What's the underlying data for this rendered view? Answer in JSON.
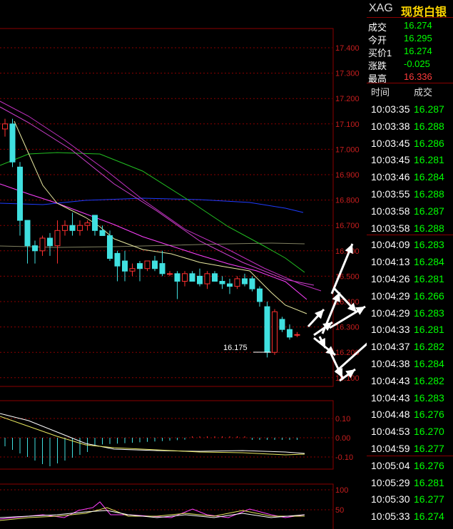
{
  "instrument": {
    "code": "XAG",
    "name": "现货白银"
  },
  "quote": [
    {
      "label": "成交",
      "value": "16.274",
      "color": "#00ff00"
    },
    {
      "label": "今开",
      "value": "16.295",
      "color": "#00ff00"
    },
    {
      "label": "买价1",
      "value": "16.274",
      "color": "#00ff00"
    },
    {
      "label": "涨跌",
      "value": "-0.025",
      "color": "#00ff00"
    },
    {
      "label": "最高",
      "value": "16.336",
      "color": "#ff3b3b"
    }
  ],
  "ticks_header": {
    "time": "时间",
    "price": "成交"
  },
  "ticks": [
    {
      "time": "10:03:35",
      "price": "16.287"
    },
    {
      "time": "10:03:38",
      "price": "16.288"
    },
    {
      "time": "10:03:45",
      "price": "16.286"
    },
    {
      "time": "10:03:45",
      "price": "16.281"
    },
    {
      "time": "10:03:46",
      "price": "16.284"
    },
    {
      "time": "10:03:55",
      "price": "16.288"
    },
    {
      "time": "10:03:58",
      "price": "16.287"
    },
    {
      "time": "10:03:58",
      "price": "16.288"
    },
    {
      "time": "10:04:09",
      "price": "16.283"
    },
    {
      "time": "10:04:13",
      "price": "16.284"
    },
    {
      "time": "10:04:26",
      "price": "16.281"
    },
    {
      "time": "10:04:29",
      "price": "16.266"
    },
    {
      "time": "10:04:29",
      "price": "16.283"
    },
    {
      "time": "10:04:33",
      "price": "16.281"
    },
    {
      "time": "10:04:37",
      "price": "16.282"
    },
    {
      "time": "10:04:38",
      "price": "16.284"
    },
    {
      "time": "10:04:43",
      "price": "16.282"
    },
    {
      "time": "10:04:43",
      "price": "16.283"
    },
    {
      "time": "10:04:48",
      "price": "16.276"
    },
    {
      "time": "10:04:53",
      "price": "16.270"
    },
    {
      "time": "10:04:59",
      "price": "16.277"
    },
    {
      "time": "10:05:04",
      "price": "16.276"
    },
    {
      "time": "10:05:29",
      "price": "16.281"
    },
    {
      "time": "10:05:30",
      "price": "16.277"
    },
    {
      "time": "10:05:33",
      "price": "16.274"
    }
  ],
  "main_chart": {
    "y_labels": [
      "17.400",
      "17.300",
      "17.200",
      "17.100",
      "17.000",
      "16.900",
      "16.800",
      "16.700",
      "16.600",
      "16.500",
      "16.400",
      "16.300",
      "16.200",
      "16.100"
    ],
    "low_marker": "16.175",
    "candles": [
      {
        "o": 17.08,
        "h": 17.12,
        "l": 17.05,
        "c": 17.1
      },
      {
        "o": 17.1,
        "h": 17.12,
        "l": 16.93,
        "c": 16.95
      },
      {
        "o": 16.93,
        "h": 16.95,
        "l": 16.66,
        "c": 16.72
      },
      {
        "o": 16.72,
        "h": 16.72,
        "l": 16.55,
        "c": 16.62
      },
      {
        "o": 16.62,
        "h": 16.64,
        "l": 16.55,
        "c": 16.6
      },
      {
        "o": 16.6,
        "h": 16.66,
        "l": 16.58,
        "c": 16.65
      },
      {
        "o": 16.65,
        "h": 16.67,
        "l": 16.58,
        "c": 16.62
      },
      {
        "o": 16.62,
        "h": 16.72,
        "l": 16.55,
        "c": 16.68
      },
      {
        "o": 16.68,
        "h": 16.72,
        "l": 16.66,
        "c": 16.7
      },
      {
        "o": 16.7,
        "h": 16.75,
        "l": 16.66,
        "c": 16.68
      },
      {
        "o": 16.68,
        "h": 16.72,
        "l": 16.66,
        "c": 16.7
      },
      {
        "o": 16.7,
        "h": 16.72,
        "l": 16.68,
        "c": 16.71
      },
      {
        "o": 16.74,
        "h": 16.74,
        "l": 16.66,
        "c": 16.68
      },
      {
        "o": 16.68,
        "h": 16.7,
        "l": 16.66,
        "c": 16.66
      },
      {
        "o": 16.66,
        "h": 16.68,
        "l": 16.56,
        "c": 16.57
      },
      {
        "o": 16.59,
        "h": 16.6,
        "l": 16.48,
        "c": 16.54
      },
      {
        "o": 16.56,
        "h": 16.6,
        "l": 16.48,
        "c": 16.52
      },
      {
        "o": 16.52,
        "h": 16.55,
        "l": 16.5,
        "c": 16.53
      },
      {
        "o": 16.55,
        "h": 16.56,
        "l": 16.48,
        "c": 16.53
      },
      {
        "o": 16.53,
        "h": 16.56,
        "l": 16.52,
        "c": 16.56
      },
      {
        "o": 16.56,
        "h": 16.58,
        "l": 16.52,
        "c": 16.53
      },
      {
        "o": 16.55,
        "h": 16.6,
        "l": 16.5,
        "c": 16.51
      },
      {
        "o": 16.51,
        "h": 16.52,
        "l": 16.5,
        "c": 16.51
      },
      {
        "o": 16.51,
        "h": 16.52,
        "l": 16.41,
        "c": 16.48
      },
      {
        "o": 16.48,
        "h": 16.52,
        "l": 16.46,
        "c": 16.51
      },
      {
        "o": 16.51,
        "h": 16.52,
        "l": 16.48,
        "c": 16.48
      },
      {
        "o": 16.5,
        "h": 16.53,
        "l": 16.46,
        "c": 16.47
      },
      {
        "o": 16.47,
        "h": 16.52,
        "l": 16.45,
        "c": 16.51
      },
      {
        "o": 16.51,
        "h": 16.52,
        "l": 16.48,
        "c": 16.48
      },
      {
        "o": 16.48,
        "h": 16.5,
        "l": 16.45,
        "c": 16.47
      },
      {
        "o": 16.47,
        "h": 16.49,
        "l": 16.43,
        "c": 16.46
      },
      {
        "o": 16.46,
        "h": 16.5,
        "l": 16.45,
        "c": 16.49
      },
      {
        "o": 16.49,
        "h": 16.51,
        "l": 16.46,
        "c": 16.47
      },
      {
        "o": 16.49,
        "h": 16.5,
        "l": 16.44,
        "c": 16.45
      },
      {
        "o": 16.45,
        "h": 16.46,
        "l": 16.38,
        "c": 16.4
      },
      {
        "o": 16.38,
        "h": 16.4,
        "l": 16.18,
        "c": 16.2
      },
      {
        "o": 16.2,
        "h": 16.37,
        "l": 16.19,
        "c": 16.36
      },
      {
        "o": 16.33,
        "h": 16.34,
        "l": 16.28,
        "c": 16.29
      },
      {
        "o": 16.29,
        "h": 16.31,
        "l": 16.25,
        "c": 16.26
      },
      {
        "o": 16.27,
        "h": 16.28,
        "l": 16.26,
        "c": 16.27
      }
    ]
  },
  "macd_chart": {
    "y_labels": [
      "0.10",
      "0.00",
      "-0.10"
    ]
  },
  "kdj_chart": {
    "y_labels": [
      "100",
      "50"
    ]
  }
}
